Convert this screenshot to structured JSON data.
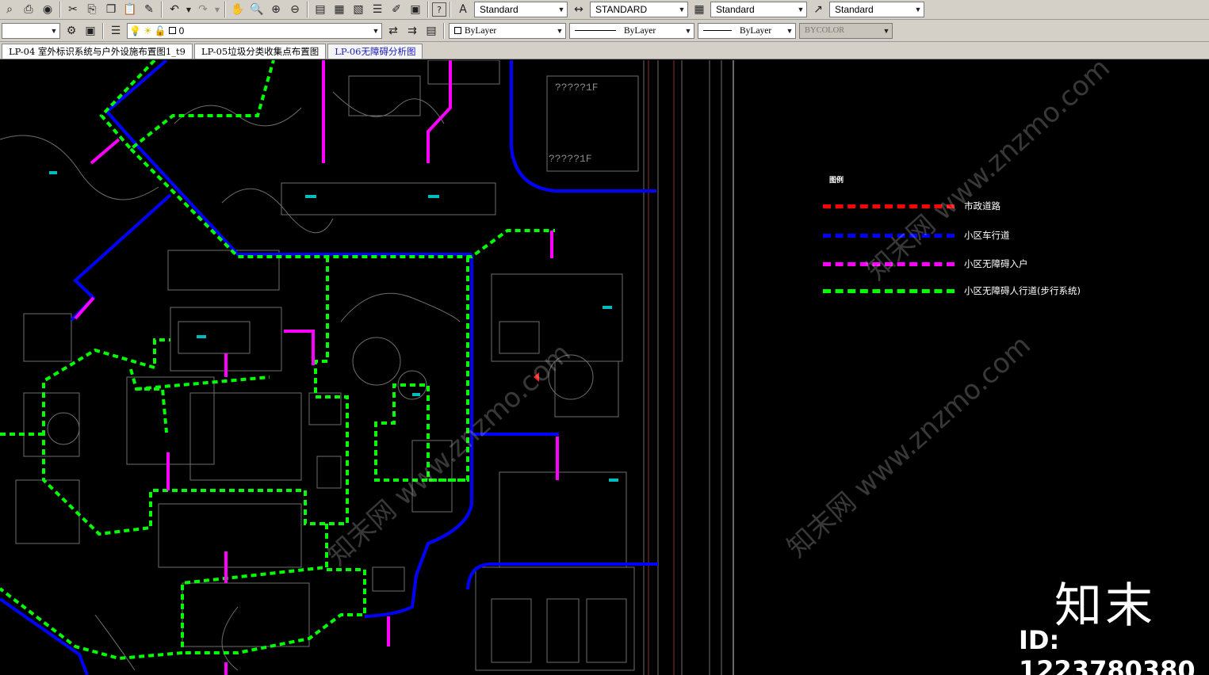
{
  "toolbar1": {
    "text_style": "Standard",
    "dim_style": "STANDARD",
    "table_style": "Standard",
    "mleader_style": "Standard"
  },
  "toolbar2": {
    "layer": "0",
    "color": "ByLayer",
    "linetype": "ByLayer",
    "lineweight": "ByLayer",
    "plotstyle": "BYCOLOR"
  },
  "tabs": [
    {
      "label": "LP-04 室外标识系统与户外设施布置图1_t9"
    },
    {
      "label": "LP-05垃圾分类收集点布置图"
    },
    {
      "label": "LP-06无障碍分析图"
    }
  ],
  "legend": {
    "title": "图例",
    "items": [
      {
        "label": "市政道路",
        "color": "#ff0000"
      },
      {
        "label": "小区车行道",
        "color": "#0000ff"
      },
      {
        "label": "小区无障碍入户",
        "color": "#ff00ff"
      },
      {
        "label": "小区无障碍人行道(步行系统)",
        "color": "#00ff00"
      }
    ]
  },
  "plan_labels": {
    "block_a": "?????1F",
    "block_b": "?????1F"
  },
  "watermark": {
    "logo": "知末",
    "id": "ID: 1223780380",
    "url": "知末网 www.znzmo.com"
  }
}
